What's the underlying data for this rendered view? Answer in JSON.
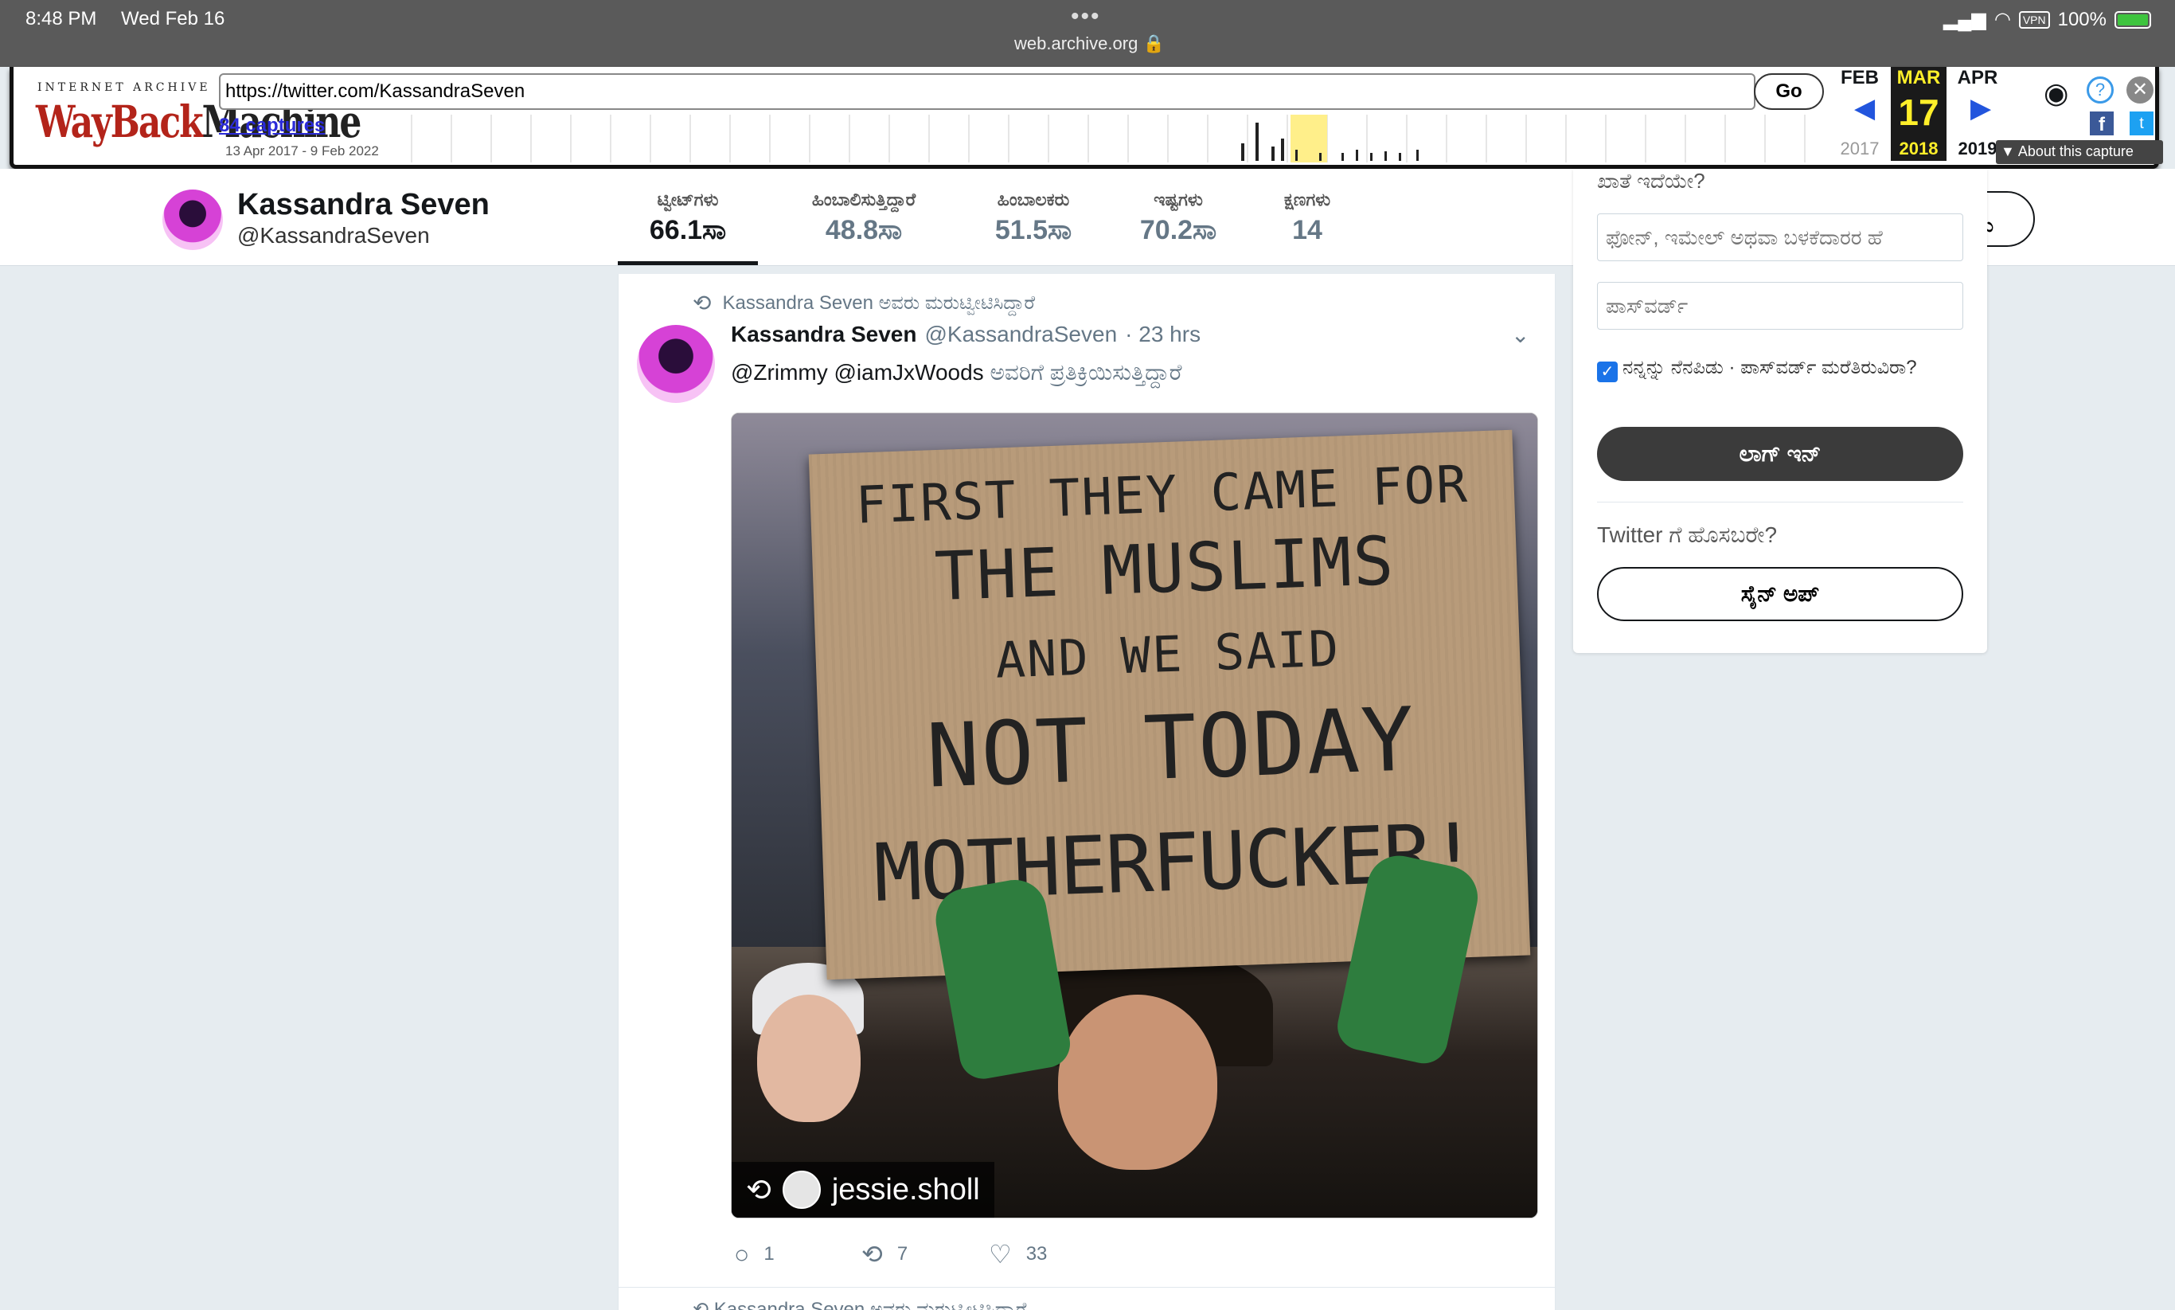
{
  "status_bar": {
    "time": "8:48 PM",
    "date": "Wed Feb 16",
    "domain": "web.archive.org",
    "vpn": "VPN",
    "battery": "100%"
  },
  "wayback": {
    "logo_top": "INTERNET ARCHIVE",
    "logo_wayback": "WayBack",
    "logo_machine": "Machine",
    "url": "https://twitter.com/KassandraSeven",
    "go_label": "Go",
    "captures": "84 captures",
    "range": "13 Apr 2017 - 9 Feb 2022",
    "prev_month": "FEB",
    "cur_month": "MAR",
    "next_month": "APR",
    "day": "17",
    "prev_year": "2017",
    "cur_year": "2018",
    "next_year": "2019",
    "about": "About this capture"
  },
  "profile": {
    "name": "Kassandra Seven",
    "handle": "@KassandraSeven",
    "stats": [
      {
        "label": "ಟ್ವೀಟ್‌ಗಳು",
        "value": "66.1ಸಾ"
      },
      {
        "label": "ಹಿಂಬಾಲಿಸುತ್ತಿದ್ದಾರೆ",
        "value": "48.8ಸಾ"
      },
      {
        "label": "ಹಿಂಬಾಲಕರು",
        "value": "51.5ಸಾ"
      },
      {
        "label": "ಇಷ್ಟಗಳು",
        "value": "70.2ಸಾ"
      },
      {
        "label": "ಕ್ಷಣಗಳು",
        "value": "14"
      }
    ],
    "follow_partial": "ಸು"
  },
  "tweet": {
    "retweet_context": "Kassandra Seven ಅವರು ಮರುಟ್ವೀಟಿಸಿದ್ದಾರೆ",
    "name": "Kassandra Seven",
    "handle": "@KassandraSeven",
    "time": "· 23 hrs",
    "reply_to": "@Zrimmy @iamJxWoods",
    "reply_suffix": "ಅವರಿಗೆ ಪ್ರತಿಕ್ರಿಯಿಸುತ್ತಿದ್ದಾರೆ",
    "sign_lines": [
      "FIRST THEY CAME FOR",
      "THE MUSLIMS",
      "AND WE SAID",
      "NOT TODAY",
      "MOTHERFUCKER!"
    ],
    "photo_credit": "jessie.sholl",
    "replies": "1",
    "retweets": "7",
    "likes": "33",
    "next_context": "Kassandra Seven ಅವರು ಮರುಟ್ವೀಟಿಸಿದ್ದಾರೆ"
  },
  "login": {
    "top_text": "ಖಾತೆ ಇದೆಯೇ?",
    "username_placeholder": "ಫೋನ್, ಇಮೇಲ್ ಅಥವಾ ಬಳಕೆದಾರರ ಹೆ",
    "password_placeholder": "ಪಾಸ್‌ವರ್ಡ್",
    "remember": "ನನ್ನನ್ನು ನೆನಪಿಡು",
    "forgot": "· ಪಾಸ್‌ವರ್ಡ್ ಮರೆತಿರುವಿರಾ?",
    "login_button": "ಲಾಗ್ ಇನ್",
    "new_question": "Twitter ಗೆ ಹೊಸಬರೇ?",
    "signup_button": "ಸೈನ್ ಅಪ್"
  }
}
